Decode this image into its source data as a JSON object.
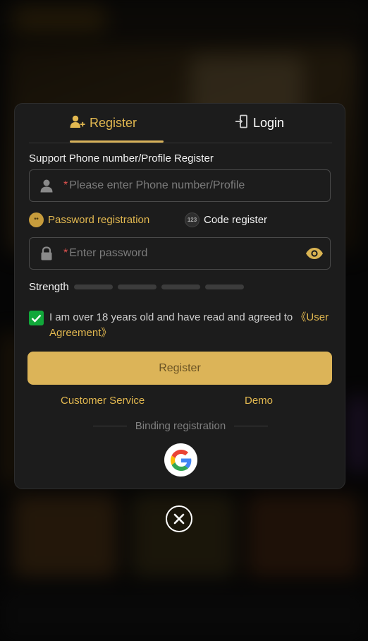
{
  "tabs": {
    "register": "Register",
    "login": "Login"
  },
  "form": {
    "support_label": "Support Phone number/Profile Register",
    "phone_placeholder": "Please enter Phone number/Profile",
    "required_mark": "*",
    "password_placeholder": "Enter password",
    "mode_password": "Password registration",
    "mode_code": "Code register",
    "mode_code_badge": "123",
    "mode_password_badge": "**",
    "strength_label": "Strength",
    "agreement_text": "I am over 18 years old and have read and agreed to ",
    "agreement_link": "《User Agreement》",
    "agreement_checked": true,
    "submit_label": "Register"
  },
  "links": {
    "customer_service": "Customer Service",
    "demo": "Demo"
  },
  "binding": {
    "label": "Binding registration",
    "providers": [
      "google-icon"
    ]
  },
  "icons": {
    "register_tab": "user-plus-icon",
    "login_tab": "login-door-icon",
    "phone_field": "user-icon",
    "password_field": "lock-icon",
    "show_password": "eye-icon",
    "close": "close-icon"
  },
  "colors": {
    "accent": "#e2b850",
    "button": "#dcb458",
    "button_text": "#6b5425",
    "modal_bg": "#1c1c1c",
    "check": "#11a83a",
    "required": "#e0524f"
  }
}
